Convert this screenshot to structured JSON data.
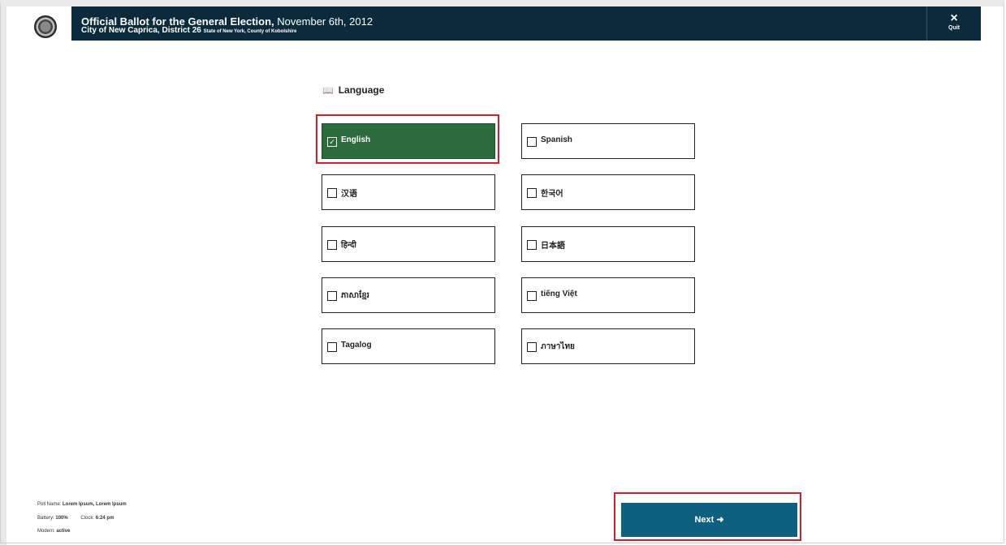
{
  "header": {
    "title_bold": "Official Ballot for the General Election,",
    "title_date": "November 6th, 2012",
    "subtitle": "City of New Caprica, District 26",
    "subtitle_small": "State of New York, County of Kobolshire",
    "quit_icon": "×",
    "quit_label": "Quit"
  },
  "language": {
    "heading": "Language",
    "icon": "language-icon",
    "options": [
      {
        "label": "English",
        "selected": true
      },
      {
        "label": "Spanish",
        "selected": false
      },
      {
        "label": "汉语",
        "selected": false
      },
      {
        "label": "한국어",
        "selected": false
      },
      {
        "label": "हिन्दी",
        "selected": false
      },
      {
        "label": "日本語",
        "selected": false
      },
      {
        "label": "ភាសាខ្មែរ",
        "selected": false
      },
      {
        "label": "tiếng Việt",
        "selected": false
      },
      {
        "label": "Tagalog",
        "selected": false
      },
      {
        "label": "ภาษาไทย",
        "selected": false
      }
    ]
  },
  "footer": {
    "poll_name_label": "Poll Name:",
    "poll_name_value": "Lorem Ipsum, Lorem Ipsum",
    "battery_label": "Battery:",
    "battery_value": "100%",
    "clock_label": "Clock:",
    "clock_value": "6:24 pm",
    "modem_label": "Modem:",
    "modem_value": "active"
  },
  "next": {
    "label": "Next",
    "icon": "arrow-right-icon"
  },
  "colors": {
    "header_bg": "#0b2b3d",
    "selected_bg": "#2c6b3c",
    "next_bg": "#0f5f7f",
    "highlight": "#d21f2b"
  }
}
